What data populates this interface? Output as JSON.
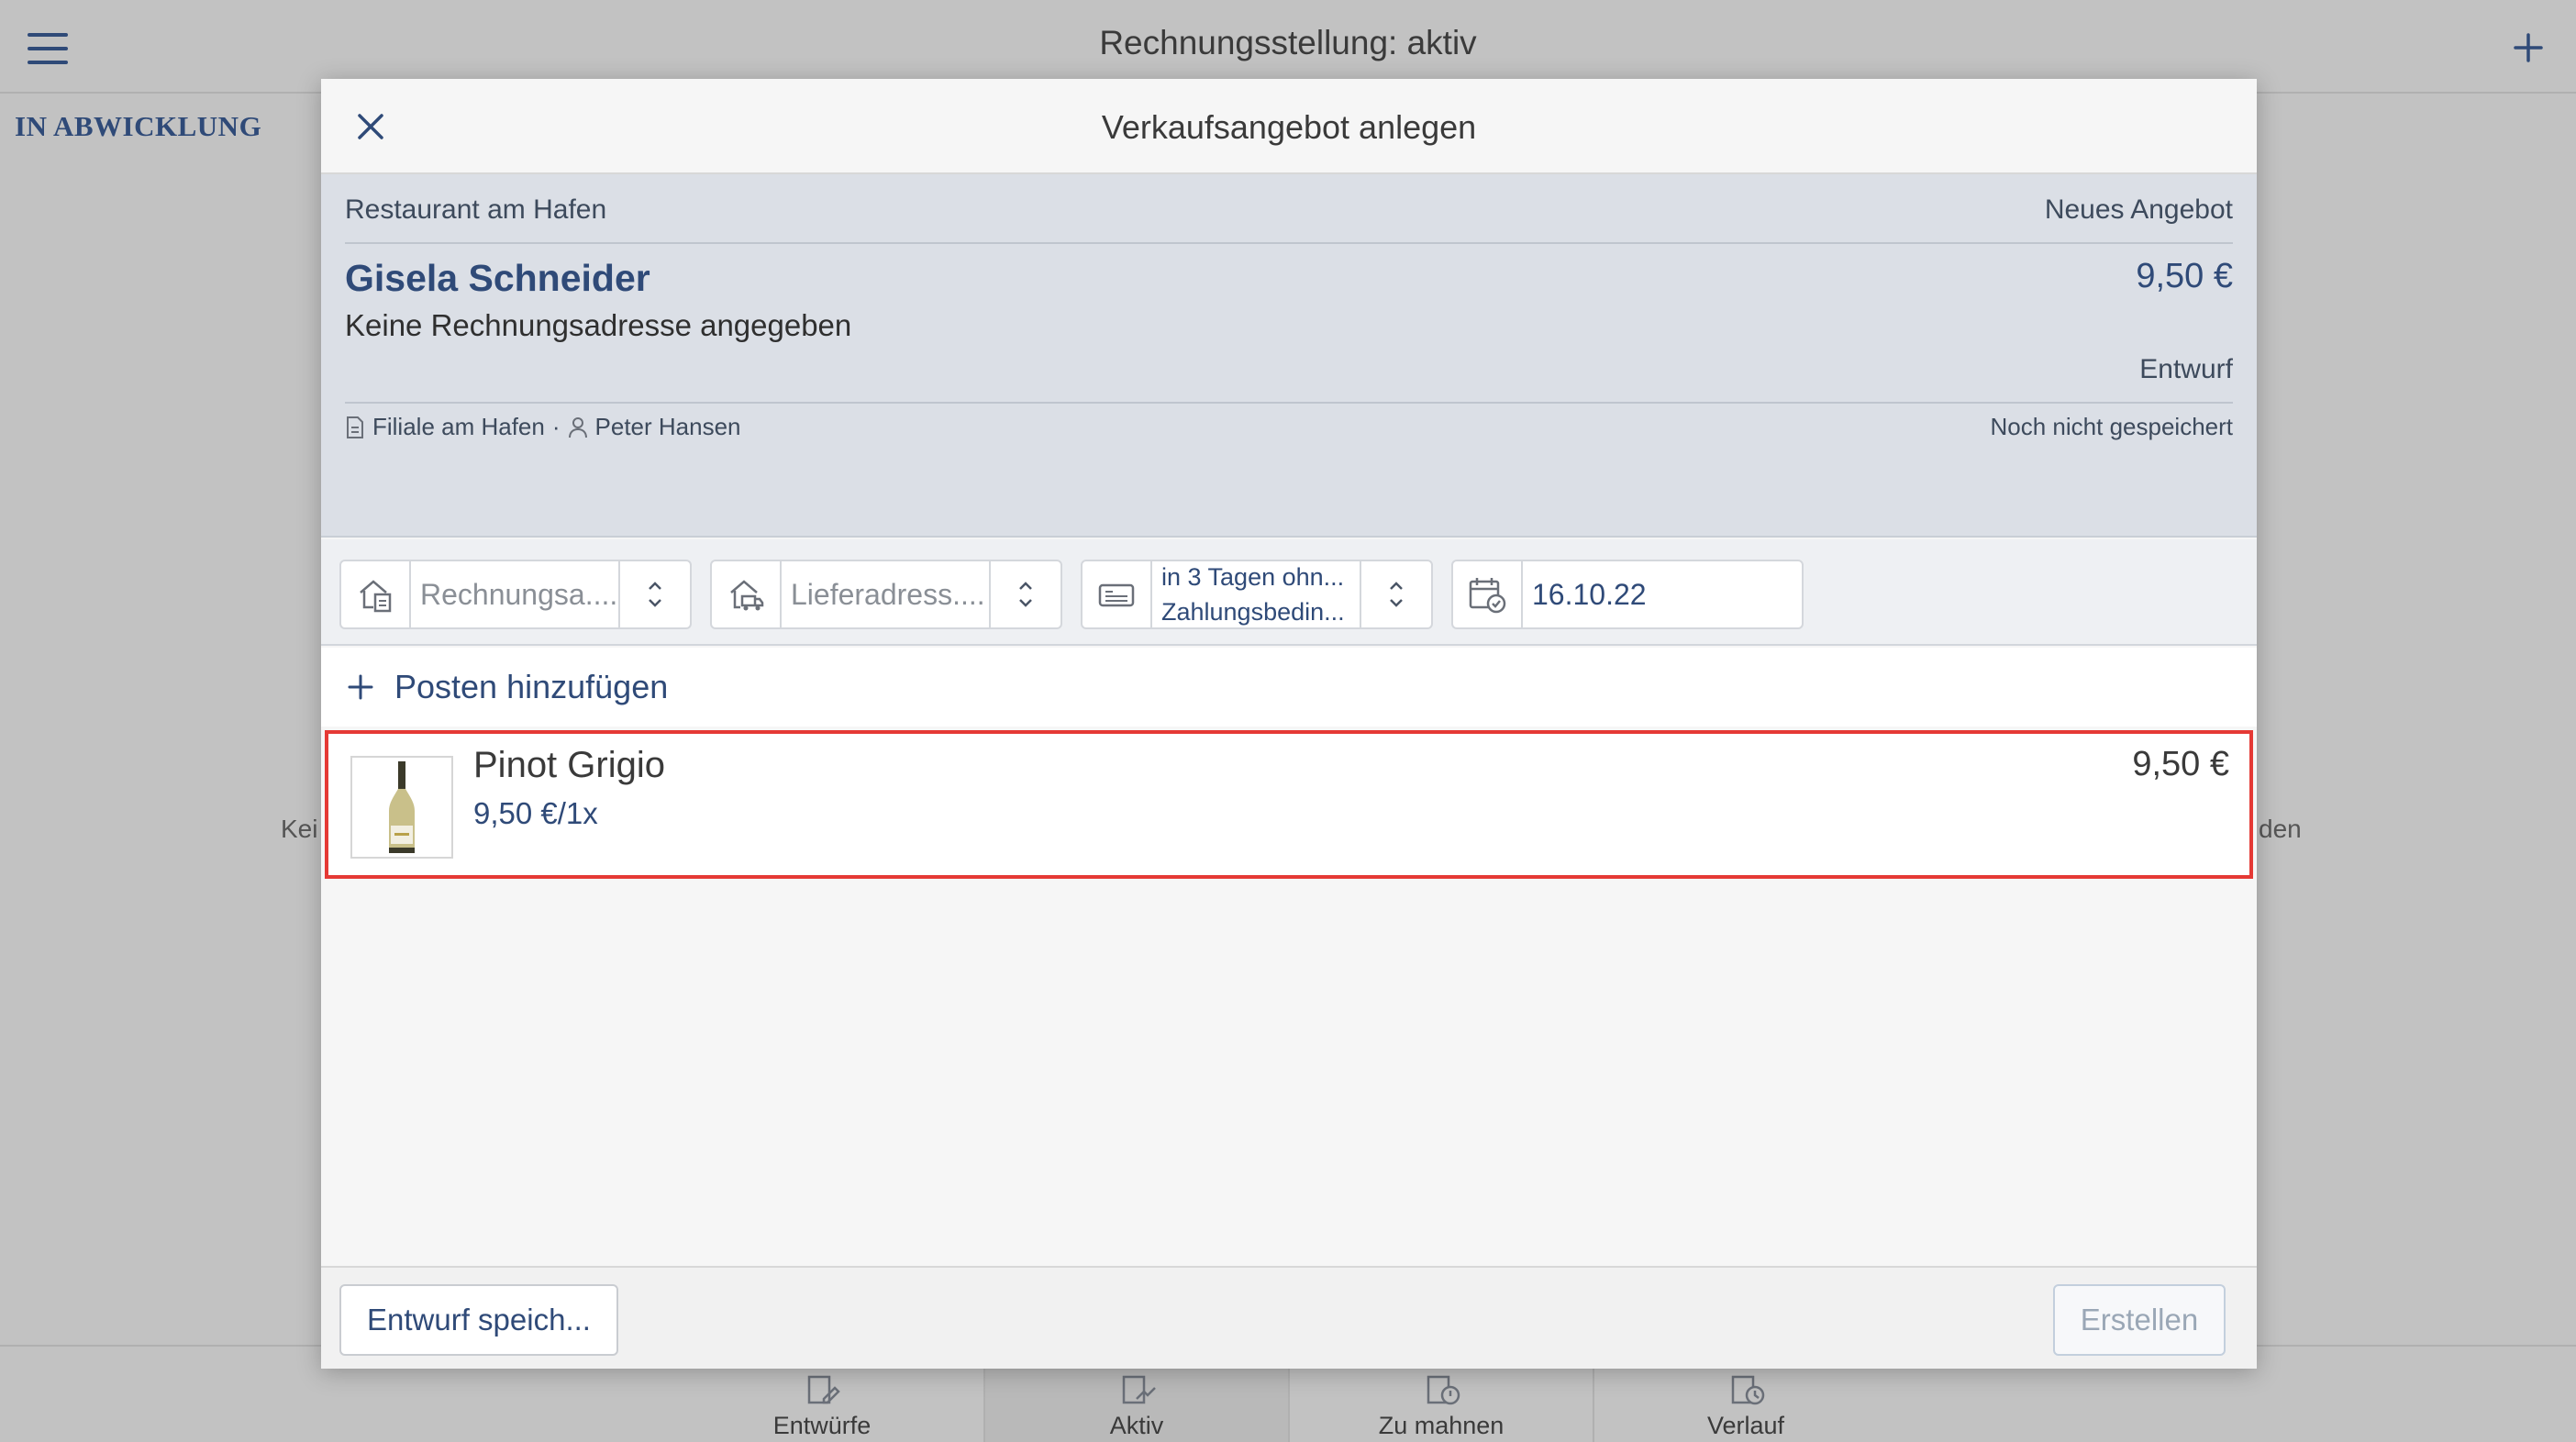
{
  "app": {
    "title": "Rechnungsstellung: aktiv",
    "section_label": "IN ABWICKLUNG",
    "empty_left_fragment": "Kei",
    "empty_right_fragment": "den"
  },
  "bottom_nav": {
    "tabs": [
      {
        "label": "Entwürfe",
        "icon": "drafts-icon"
      },
      {
        "label": "Aktiv",
        "icon": "active-invoice-icon",
        "active": true
      },
      {
        "label": "Zu mahnen",
        "icon": "reminder-icon"
      },
      {
        "label": "Verlauf",
        "icon": "history-icon"
      }
    ]
  },
  "dialog": {
    "title": "Verkaufsangebot anlegen",
    "summary": {
      "restaurant": "Restaurant am Hafen",
      "offer_label": "Neues Angebot",
      "customer": "Gisela Schneider",
      "total": "9,50 €",
      "address_note": "Keine Rechnungsadresse angegeben",
      "status": "Entwurf",
      "branch": "Filiale am Hafen",
      "separator": "·",
      "user": "Peter Hansen",
      "save_state": "Noch nicht gespeichert"
    },
    "fields": {
      "billing_placeholder": "Rechnungsa....",
      "delivery_placeholder": "Lieferadress....",
      "payment_line1": "in 3 Tagen ohn...",
      "payment_line2": "Zahlungsbedin...",
      "date": "16.10.22"
    },
    "add_item_label": "Posten hinzufügen",
    "items": [
      {
        "name": "Pinot Grigio",
        "unit_price": "9,50 €/1x",
        "price": "9,50 €"
      }
    ],
    "footer": {
      "save_draft": "Entwurf speich...",
      "create": "Erstellen"
    }
  },
  "colors": {
    "accent": "#2f4a78",
    "backdrop": "#c2c2c2",
    "summary_bg": "#dbdfe6",
    "highlight": "#e53935"
  }
}
